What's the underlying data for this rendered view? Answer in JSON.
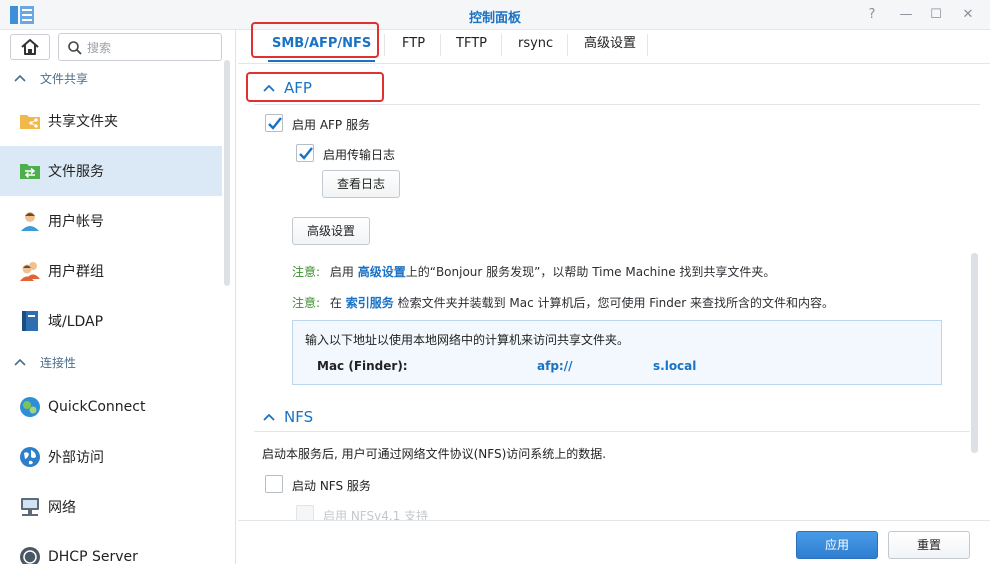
{
  "window": {
    "title": "控制面板",
    "controls": {
      "help": "?",
      "minimize": "—",
      "maximize": "☐",
      "close": "✕"
    }
  },
  "search": {
    "placeholder": "搜索"
  },
  "sidebar": {
    "sections": [
      {
        "label": "文件共享"
      },
      {
        "label": "连接性"
      }
    ],
    "items": [
      {
        "label": "共享文件夹",
        "icon": "shared-folder-icon"
      },
      {
        "label": "文件服务",
        "icon": "file-services-icon",
        "active": true
      },
      {
        "label": "用户帐号",
        "icon": "user-icon"
      },
      {
        "label": "用户群组",
        "icon": "group-icon"
      },
      {
        "label": "域/LDAP",
        "icon": "domain-ldap-icon"
      },
      {
        "label": "QuickConnect",
        "icon": "quickconnect-icon"
      },
      {
        "label": "外部访问",
        "icon": "external-access-icon"
      },
      {
        "label": "网络",
        "icon": "network-icon"
      },
      {
        "label": "DHCP Server",
        "icon": "dhcp-server-icon"
      }
    ]
  },
  "tabs": [
    {
      "label": "SMB/AFP/NFS",
      "active": true
    },
    {
      "label": "FTP"
    },
    {
      "label": "TFTP"
    },
    {
      "label": "rsync"
    },
    {
      "label": "高级设置"
    }
  ],
  "afp": {
    "title": "AFP",
    "enable_label": "启用 AFP 服务",
    "enable_checked": true,
    "log_label": "启用传输日志",
    "log_checked": true,
    "view_log_button": "查看日志",
    "advanced_button": "高级设置",
    "note1": {
      "prefix": "注意:",
      "before": "启用",
      "link": "高级设置",
      "after": "上的“Bonjour 服务发现”，以帮助 Time Machine 找到共享文件夹。"
    },
    "note2": {
      "prefix": "注意:",
      "before": "在",
      "link": "索引服务",
      "after": "检索文件夹并装载到 Mac 计算机后，您可使用 Finder 来查找所含的文件和内容。"
    },
    "address_intro": "输入以下地址以使用本地网络中的计算机来访问共享文件夹。",
    "address_label": "Mac (Finder):",
    "address_prefix": "afp://",
    "address_suffix": "s.local"
  },
  "nfs": {
    "title": "NFS",
    "description": "启动本服务后, 用户可通过网络文件协议(NFS)访问系统上的数据.",
    "enable_label": "启动 NFS 服务",
    "enable_checked": false,
    "nfsv41_label": "启用 NFSv4.1 支持"
  },
  "footer": {
    "apply": "应用",
    "reset": "重置"
  },
  "colors": {
    "accent": "#1a72c5",
    "note_label": "#3a8f2d",
    "highlight": "#e0302f",
    "active_item_bg": "#dbe9f7"
  }
}
